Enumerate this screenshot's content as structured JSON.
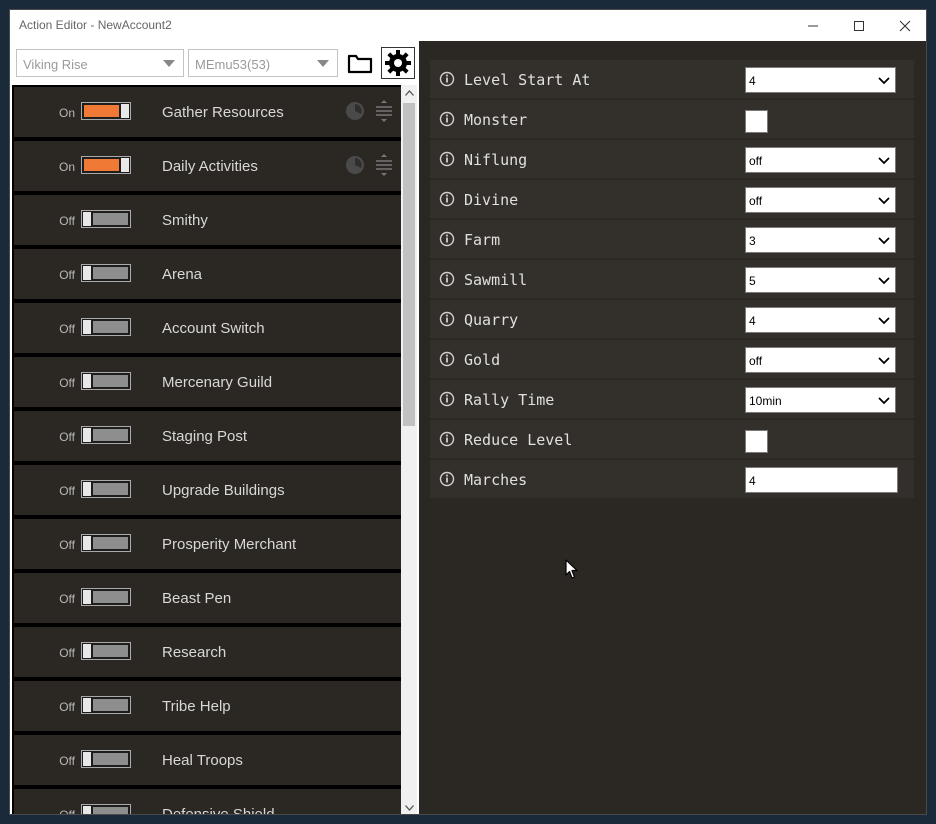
{
  "window": {
    "title": "Action Editor - NewAccount2",
    "controls": [
      "minimize",
      "maximize",
      "close"
    ]
  },
  "toolbar": {
    "game_select": {
      "value": "Viking Rise"
    },
    "emulator_select": {
      "value": "MEmu53(53)"
    },
    "folder_button_icon": "folder-icon",
    "settings_button_icon": "gear-icon"
  },
  "actions": [
    {
      "state": "On",
      "on": true,
      "label": "Gather Resources",
      "has_schedule": true
    },
    {
      "state": "On",
      "on": true,
      "label": "Daily Activities",
      "has_schedule": true
    },
    {
      "state": "Off",
      "on": false,
      "label": "Smithy"
    },
    {
      "state": "Off",
      "on": false,
      "label": "Arena"
    },
    {
      "state": "Off",
      "on": false,
      "label": "Account Switch"
    },
    {
      "state": "Off",
      "on": false,
      "label": "Mercenary Guild"
    },
    {
      "state": "Off",
      "on": false,
      "label": "Staging Post"
    },
    {
      "state": "Off",
      "on": false,
      "label": "Upgrade Buildings"
    },
    {
      "state": "Off",
      "on": false,
      "label": "Prosperity Merchant"
    },
    {
      "state": "Off",
      "on": false,
      "label": "Beast Pen"
    },
    {
      "state": "Off",
      "on": false,
      "label": "Research"
    },
    {
      "state": "Off",
      "on": false,
      "label": "Tribe Help"
    },
    {
      "state": "Off",
      "on": false,
      "label": "Heal Troops"
    },
    {
      "state": "Off",
      "on": false,
      "label": "Defensive Shield"
    }
  ],
  "properties": [
    {
      "name": "Level Start At",
      "type": "select",
      "value": "4"
    },
    {
      "name": "Monster",
      "type": "checkbox",
      "value": ""
    },
    {
      "name": "Niflung",
      "type": "select",
      "value": "off"
    },
    {
      "name": "Divine",
      "type": "select",
      "value": "off"
    },
    {
      "name": "Farm",
      "type": "select",
      "value": "3"
    },
    {
      "name": "Sawmill",
      "type": "select",
      "value": "5"
    },
    {
      "name": "Quarry",
      "type": "select",
      "value": "4"
    },
    {
      "name": "Gold",
      "type": "select",
      "value": "off"
    },
    {
      "name": "Rally Time",
      "type": "select",
      "value": "10min"
    },
    {
      "name": "Reduce Level",
      "type": "checkbox",
      "value": ""
    },
    {
      "name": "Marches",
      "type": "text",
      "value": "4"
    }
  ],
  "colors": {
    "accent_on": "#f07a35",
    "panel_bg": "#2b2722",
    "row_bg": "#332f2a"
  }
}
